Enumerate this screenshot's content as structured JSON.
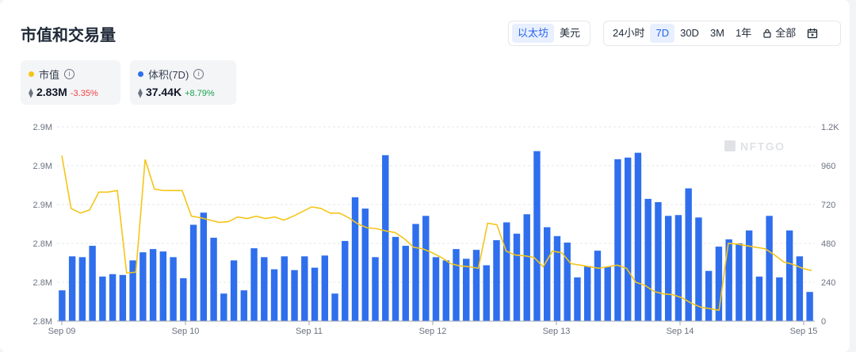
{
  "title": "市值和交易量",
  "currency_toggle": {
    "options": [
      "以太坊",
      "美元"
    ],
    "active": 0
  },
  "range_toggle": {
    "options": [
      "24小时",
      "7D",
      "30D",
      "3M",
      "1年",
      "全部"
    ],
    "active": 1
  },
  "stats": {
    "market_cap": {
      "label": "市值",
      "eth_symbol": "⧫",
      "value": "2.83M",
      "change": "-3.35%",
      "color": "#f5c518"
    },
    "volume": {
      "label": "体积(7D)",
      "eth_symbol": "⧫",
      "value": "37.44K",
      "change": "+8.79%",
      "color": "#2f6fed"
    }
  },
  "watermark": "NFTGO",
  "chart_data": {
    "type": "bar+line",
    "x_ticks": [
      "Sep 09",
      "Sep 10",
      "Sep 11",
      "Sep 12",
      "Sep 13",
      "Sep 14",
      "Sep 15"
    ],
    "left_axis": {
      "ticks": [
        "2.9M",
        "2.9M",
        "2.9M",
        "2.8M",
        "2.8M",
        "2.8M"
      ],
      "range": [
        2.75,
        3.0
      ]
    },
    "right_axis": {
      "ticks": [
        "1.2K",
        "960",
        "720",
        "480",
        "240",
        "0"
      ],
      "range": [
        0,
        1200
      ]
    },
    "series": [
      {
        "name": "体积(7D)",
        "type": "bar",
        "color": "#2f6fed",
        "values": [
          190,
          400,
          395,
          465,
          275,
          290,
          285,
          375,
          425,
          445,
          430,
          395,
          265,
          595,
          670,
          515,
          170,
          375,
          190,
          450,
          395,
          320,
          400,
          315,
          400,
          330,
          405,
          170,
          495,
          765,
          695,
          395,
          1025,
          520,
          465,
          600,
          650,
          395,
          375,
          445,
          385,
          440,
          345,
          500,
          610,
          540,
          660,
          1050,
          580,
          525,
          485,
          270,
          340,
          435,
          335,
          1000,
          1010,
          1040,
          755,
          735,
          650,
          655,
          820,
          640,
          310,
          460,
          505,
          480,
          560,
          275,
          650,
          270,
          560,
          400,
          180
        ],
        "gridline_label_note": ""
      },
      {
        "name": "市值",
        "type": "line",
        "color": "#f5c518",
        "values": [
          2.963,
          2.895,
          2.889,
          2.893,
          2.916,
          2.916,
          2.918,
          2.812,
          2.813,
          2.958,
          2.92,
          2.918,
          2.918,
          2.918,
          2.885,
          2.883,
          2.88,
          2.877,
          2.878,
          2.884,
          2.882,
          2.885,
          2.882,
          2.884,
          2.88,
          2.885,
          2.891,
          2.897,
          2.895,
          2.889,
          2.889,
          2.883,
          2.875,
          2.87,
          2.869,
          2.866,
          2.864,
          2.856,
          2.845,
          2.843,
          2.838,
          2.832,
          2.824,
          2.821,
          2.82,
          2.818,
          2.876,
          2.874,
          2.84,
          2.835,
          2.834,
          2.832,
          2.82,
          2.84,
          2.838,
          2.824,
          2.822,
          2.82,
          2.818,
          2.82,
          2.822,
          2.818,
          2.8,
          2.796,
          2.788,
          2.785,
          2.784,
          2.78,
          2.773,
          2.768,
          2.766,
          2.764,
          2.85,
          2.849,
          2.847,
          2.845,
          2.843,
          2.835,
          2.826,
          2.823,
          2.818,
          2.815
        ]
      }
    ]
  }
}
